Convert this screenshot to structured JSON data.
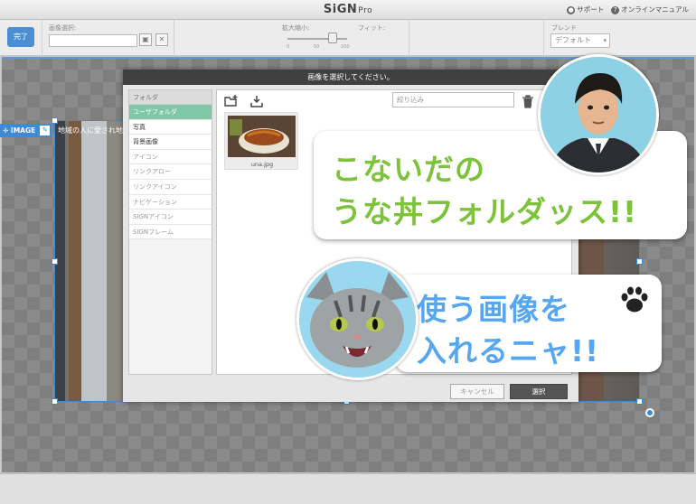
{
  "app": {
    "title": "SiGN",
    "title_suffix": "Pro"
  },
  "header_links": {
    "support": "サポート",
    "manual": "オンラインマニュアル"
  },
  "toolbar": {
    "done_label": "完了",
    "image_select_label": "画像選択:",
    "scale_label": "拡大縮小:",
    "fit_label": "フィット:",
    "blend_label": "ブレンド",
    "blend_value": "デフォルト",
    "slider_ticks": [
      "0",
      "50",
      "100"
    ]
  },
  "canvas": {
    "image_tag_label": "IMAGE",
    "behind_text": "地域の人に愛され地元の"
  },
  "dialog": {
    "title": "画像を選択してください。",
    "folder_header": "フォルダ",
    "folders": [
      "ユーザフォルダ",
      "写真",
      "背景画像",
      "アイコン",
      "リンクアロー",
      "リンクアイコン",
      "ナビゲーション",
      "SIGNアイコン",
      "SIGNフレーム"
    ],
    "filter_placeholder": "絞り込み",
    "files": [
      {
        "name": "una.jpg"
      }
    ],
    "cancel_label": "キャンセル",
    "select_label": "選択"
  },
  "bubbles": {
    "man_lines": [
      "こないだの",
      "うな丼フォルダッス!!"
    ],
    "cat_lines": [
      "使う画像を",
      "入れるニャ!!"
    ]
  },
  "colors": {
    "accent": "#4a8fd4",
    "selection": "#3c8ad8",
    "active_folder": "#7ec7a7",
    "green_text": "#7cc23a",
    "blue_text": "#58a6ee"
  }
}
